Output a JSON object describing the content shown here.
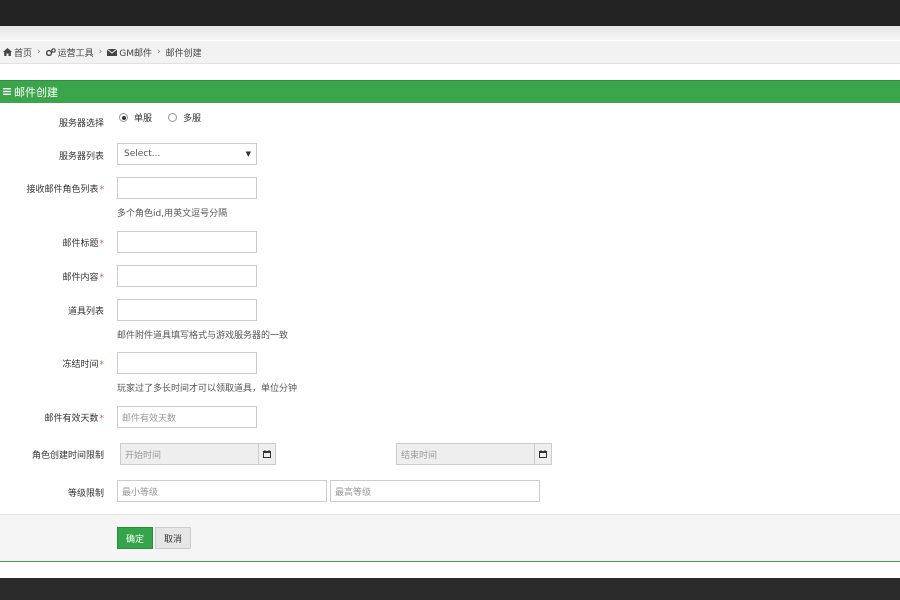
{
  "breadcrumb": {
    "home": "首页",
    "tools": "运营工具",
    "gm_mail": "GM邮件",
    "current": "邮件创建"
  },
  "panel": {
    "title": "邮件创建"
  },
  "form": {
    "server_select": {
      "label": "服务器选择",
      "options": [
        "单服",
        "多服"
      ],
      "selected": "单服"
    },
    "server_list": {
      "label": "服务器列表",
      "value": "Select..."
    },
    "recipients": {
      "label": "接收邮件角色列表",
      "required_mark": "*",
      "help": "多个角色id,用英文逗号分隔"
    },
    "mail_title": {
      "label": "邮件标题",
      "required_mark": "*"
    },
    "mail_content": {
      "label": "邮件内容",
      "required_mark": "*"
    },
    "items": {
      "label": "道具列表",
      "help": "邮件附件道具填写格式与游戏服务器的一致"
    },
    "freeze_time": {
      "label": "冻结时间",
      "required_mark": "*",
      "help": "玩家过了多长时间才可以领取道具，单位分钟"
    },
    "valid_days": {
      "label": "邮件有效天数",
      "required_mark": "*",
      "placeholder": "邮件有效天数"
    },
    "role_create_limit": {
      "label": "角色创建时间限制",
      "start_placeholder": "开始时间",
      "end_placeholder": "结束时间"
    },
    "level_limit": {
      "label": "等级限制",
      "min_placeholder": "最小等级",
      "max_placeholder": "最高等级"
    }
  },
  "buttons": {
    "ok": "确定",
    "cancel": "取消"
  },
  "colors": {
    "accent": "#3aa54a",
    "required": "#d9534f",
    "topbar": "#232323"
  }
}
